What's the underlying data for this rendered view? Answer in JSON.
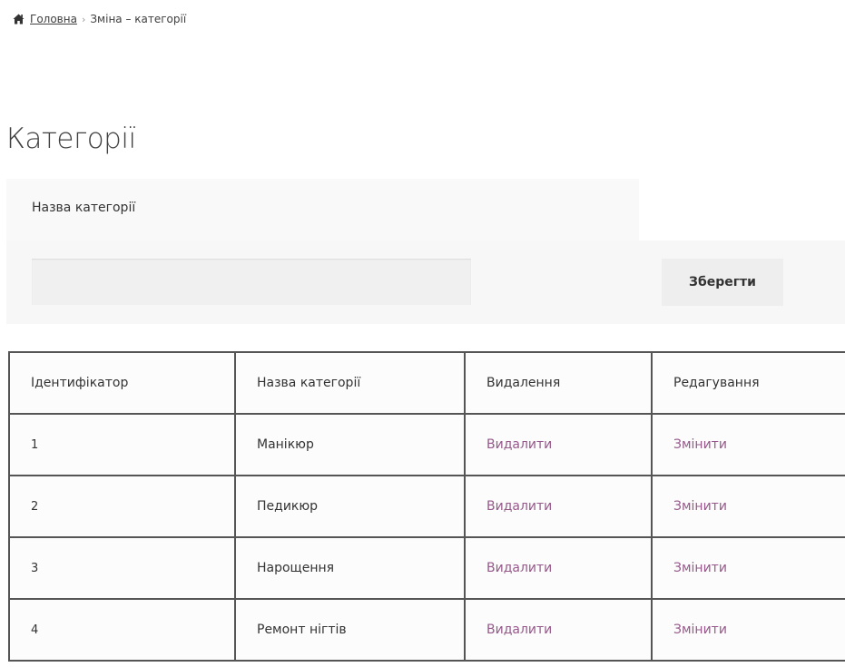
{
  "breadcrumb": {
    "home_icon": "home-icon",
    "home_label": "Головна",
    "separator": "›",
    "current": "Зміна – категорії"
  },
  "page_title": "Категорії",
  "form": {
    "label": "Назва категорії",
    "input_value": "",
    "save_label": "Зберегти"
  },
  "colors": {
    "link": "#96588a",
    "table_border": "#555555"
  },
  "table": {
    "headers": [
      "Ідентифікатор",
      "Назва категорії",
      "Видалення",
      "Редагування"
    ],
    "rows": [
      {
        "id": "1",
        "name": "Манікюр",
        "delete": "Видалити",
        "edit": "Змінити"
      },
      {
        "id": "2",
        "name": "Педикюр",
        "delete": "Видалити",
        "edit": "Змінити"
      },
      {
        "id": "3",
        "name": "Нарощення",
        "delete": "Видалити",
        "edit": "Змінити"
      },
      {
        "id": "4",
        "name": "Ремонт нігтів",
        "delete": "Видалити",
        "edit": "Змінити"
      }
    ]
  }
}
